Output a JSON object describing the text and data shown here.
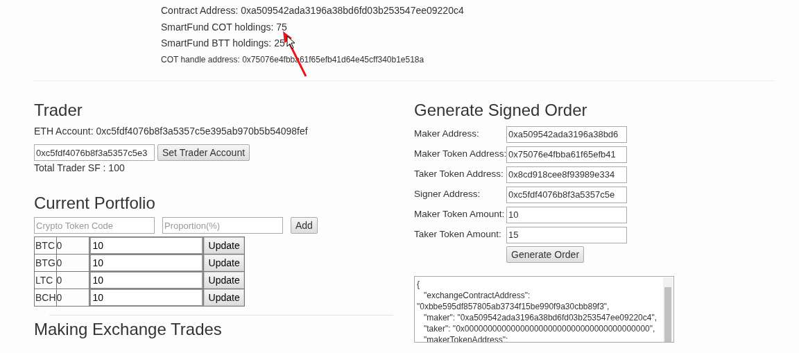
{
  "header": {
    "lines": [
      {
        "label": "Contract Address: 0xa509542ada3196a38bd6fd03b253547ee09220c4",
        "kind": "normal"
      },
      {
        "label": "SmartFund COT holdings: 75",
        "kind": "normal"
      },
      {
        "label": "SmartFund BTT holdings: 25",
        "kind": "normal"
      },
      {
        "label": "COT handle address: 0x75076e4fbba61f65efb41d64e45cff340b1e518a",
        "kind": "small"
      }
    ]
  },
  "trader": {
    "title": "Trader",
    "account": "ETH Account: 0xc5fdf4076b8f3a5357c5e395ab970b5b54098fef",
    "input_value": "0xc5fdf4076b8f3a5357c5e3",
    "button": "Set Trader Account",
    "total": "Total Trader SF : 100"
  },
  "portfolio": {
    "title": "Current Portfolio",
    "code_placeholder": "Crypto Token Code",
    "proportion_placeholder": "Proportion(%)",
    "add_button": "Add",
    "rows": [
      {
        "code": "BTC",
        "amount": "0",
        "value": "10",
        "button": "Update"
      },
      {
        "code": "BTG",
        "amount": "0",
        "value": "10",
        "button": "Update"
      },
      {
        "code": "LTC",
        "amount": "0",
        "value": "10",
        "button": "Update"
      },
      {
        "code": "BCH",
        "amount": "0",
        "value": "10",
        "button": "Update"
      }
    ]
  },
  "next_section": {
    "title": "Making Exchange Trades"
  },
  "order": {
    "title": "Generate Signed Order",
    "fields": [
      {
        "label": "Maker Address:",
        "value": "0xa509542ada3196a38bd6"
      },
      {
        "label": "Maker Token Address:",
        "value": "0x75076e4fbba61f65efb41"
      },
      {
        "label": "Taker Token Address:",
        "value": "0x8cd918cee8f93989e334"
      },
      {
        "label": "Signer Address:",
        "value": "0xc5fdf4076b8f3a5357c5e"
      },
      {
        "label": "Maker Token Amount:",
        "value": "10"
      },
      {
        "label": "Taker Token Amount:",
        "value": "15"
      }
    ],
    "button": "Generate Order",
    "output_lines": [
      "{",
      "   \"exchangeContractAddress\":",
      "\"0xbbe595df857805ab3734f15be990f9a30cbb89f3\",",
      "   \"maker\": \"0xa509542ada3196a38bd6fd03b253547ee09220c4\",",
      "   \"taker\": \"0x0000000000000000000000000000000000000000\",",
      "   \"makerTokenAddress\":"
    ]
  }
}
